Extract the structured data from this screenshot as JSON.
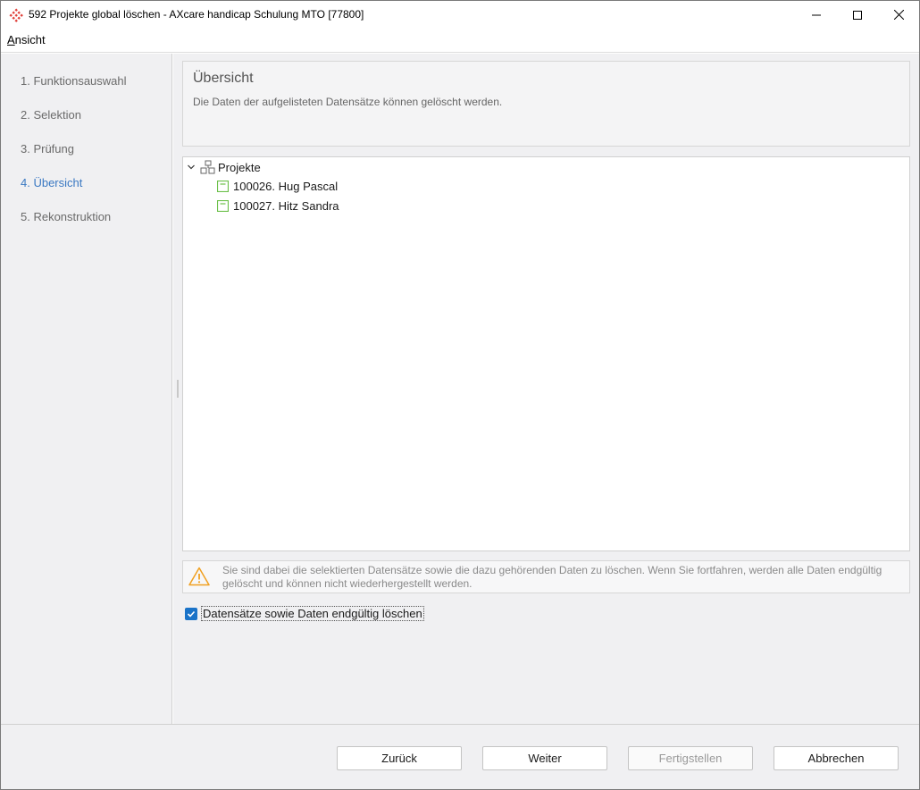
{
  "window": {
    "title": "592 Projekte global löschen - AXcare handicap Schulung MTO [77800]"
  },
  "menu": {
    "ansicht_underlined": "A",
    "ansicht_rest": "nsicht"
  },
  "steps": [
    {
      "label": "1. Funktionsauswahl",
      "active": false
    },
    {
      "label": "2. Selektion",
      "active": false
    },
    {
      "label": "3. Prüfung",
      "active": false
    },
    {
      "label": "4. Übersicht",
      "active": true
    },
    {
      "label": "5. Rekonstruktion",
      "active": false
    }
  ],
  "header": {
    "title": "Übersicht",
    "description": "Die Daten der aufgelisteten Datensätze können gelöscht werden."
  },
  "tree": {
    "root_label": "Projekte",
    "root_icon": "hierarchy-icon",
    "children": [
      {
        "label": "100026. Hug Pascal",
        "icon": "record-icon"
      },
      {
        "label": "100027. Hitz Sandra",
        "icon": "record-icon"
      }
    ]
  },
  "warning": {
    "text": "Sie sind dabei die selektierten Datensätze sowie die dazu gehörenden Daten zu löschen. Wenn Sie fortfahren, werden alle Daten endgültig gelöscht und können nicht wiederhergestellt werden."
  },
  "confirm": {
    "label": "Datensätze sowie Daten endgültig löschen",
    "checked": true
  },
  "buttons": {
    "back": "Zurück",
    "next": "Weiter",
    "finish": "Fertigstellen",
    "cancel": "Abbrechen"
  },
  "colors": {
    "accent": "#3a78c2",
    "checkbox": "#1a73c8",
    "record_icon": "#6cc04a",
    "warning_icon": "#f0a020",
    "app_icon": "#e0403a"
  }
}
